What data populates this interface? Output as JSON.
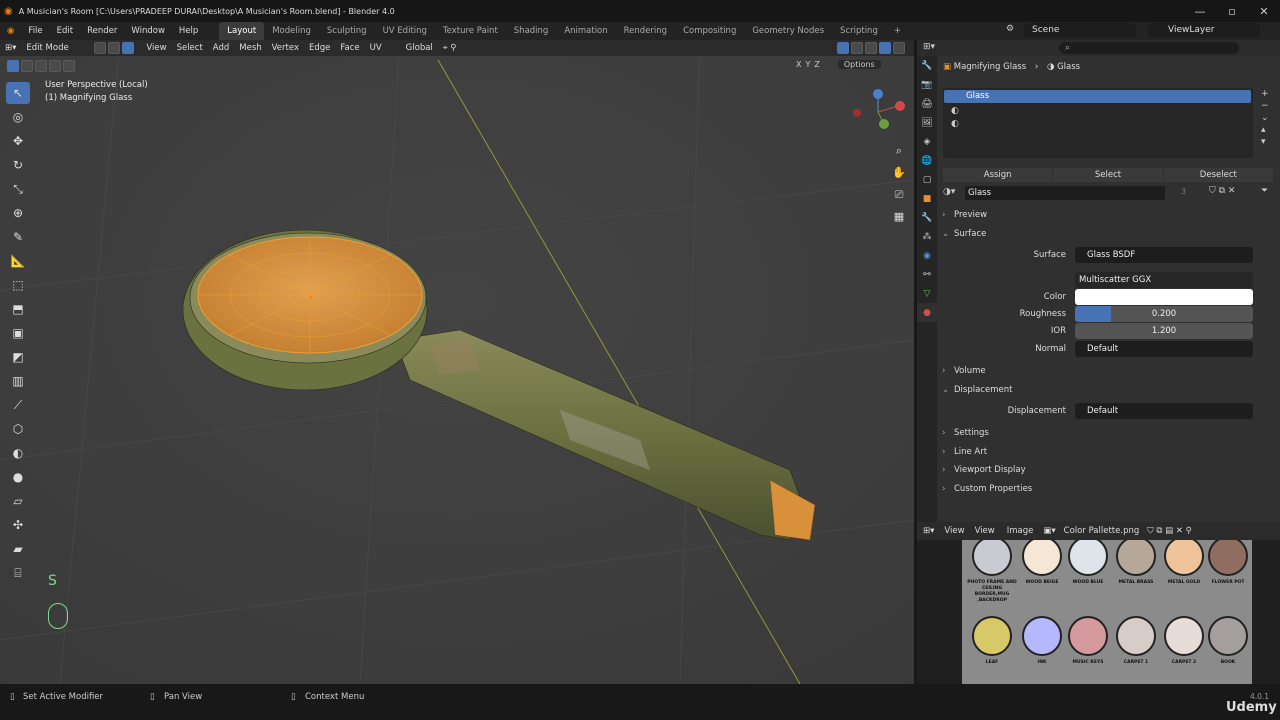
{
  "window": {
    "title": "A Musician's Room [C:\\Users\\PRADEEP DURAI\\Desktop\\A Musician's Room.blend] - Blender 4.0"
  },
  "menus": [
    "File",
    "Edit",
    "Render",
    "Window",
    "Help"
  ],
  "workspaces": [
    "Layout",
    "Modeling",
    "Sculpting",
    "UV Editing",
    "Texture Paint",
    "Shading",
    "Animation",
    "Rendering",
    "Compositing",
    "Geometry Nodes",
    "Scripting"
  ],
  "scene": {
    "label": "Scene",
    "viewlayer": "ViewLayer"
  },
  "viewport": {
    "mode": "Edit Mode",
    "menus": [
      "View",
      "Select",
      "Add",
      "Mesh",
      "Vertex",
      "Edge",
      "Face",
      "UV"
    ],
    "orientation": "Global",
    "options": "Options",
    "xyz": [
      "X",
      "Y",
      "Z"
    ],
    "overlay_line1": "User Perspective (Local)",
    "overlay_line2": "(1) Magnifying Glass",
    "key_pressed": "S"
  },
  "properties": {
    "breadcrumb_object": "Magnifying Glass",
    "breadcrumb_material": "Glass",
    "slot_selected": "Glass",
    "assign": "Assign",
    "select": "Select",
    "deselect": "Deselect",
    "material_name": "Glass",
    "user_count": "3",
    "panels": {
      "preview": "Preview",
      "surface": "Surface",
      "volume": "Volume",
      "displacement": "Displacement",
      "settings": "Settings",
      "line_art": "Line Art",
      "viewport_display": "Viewport Display",
      "custom_properties": "Custom Properties"
    },
    "surface": {
      "label": "Surface",
      "value": "Glass BSDF",
      "distribution": "Multiscatter GGX",
      "color_label": "Color",
      "roughness_label": "Roughness",
      "roughness": "0.200",
      "roughness_fraction": 0.2,
      "ior_label": "IOR",
      "ior": "1.200",
      "normal_label": "Normal",
      "normal": "Default"
    },
    "displacement": {
      "label": "Displacement",
      "value": "Default"
    }
  },
  "image_editor": {
    "view": "View",
    "menu_view": "View",
    "menu_image": "Image",
    "image_name": "Color Pallette.png"
  },
  "palette": [
    {
      "label": "PHOTO FRAME AND CEILING BORDER,MUG ,BACKDROP",
      "color": "#c8ccd2"
    },
    {
      "label": "WOOD BEIGE",
      "color": "#f6e6d6"
    },
    {
      "label": "WOOD BLUE",
      "color": "#dfe4ea"
    },
    {
      "label": "METAL BRASS",
      "color": "#b6a898"
    },
    {
      "label": "METAL GOLD",
      "color": "#f0c49a"
    },
    {
      "label": "FLOWER POT",
      "color": "#8f6e60"
    },
    {
      "label": "LEAF",
      "color": "#d8c968"
    },
    {
      "label": "INK",
      "color": "#b6b8ff"
    },
    {
      "label": "MUSIC KEYS",
      "color": "#d69a9e"
    },
    {
      "label": "CARPET 1",
      "color": "#d8ccc8"
    },
    {
      "label": "CARPET 2",
      "color": "#e8dcd8"
    },
    {
      "label": "BOOK",
      "color": "#a49e9e"
    }
  ],
  "status": {
    "left": "Set Active Modifier",
    "mid": "Pan View",
    "right": "Context Menu",
    "version": "4.0.1",
    "watermark": "Udemy"
  }
}
